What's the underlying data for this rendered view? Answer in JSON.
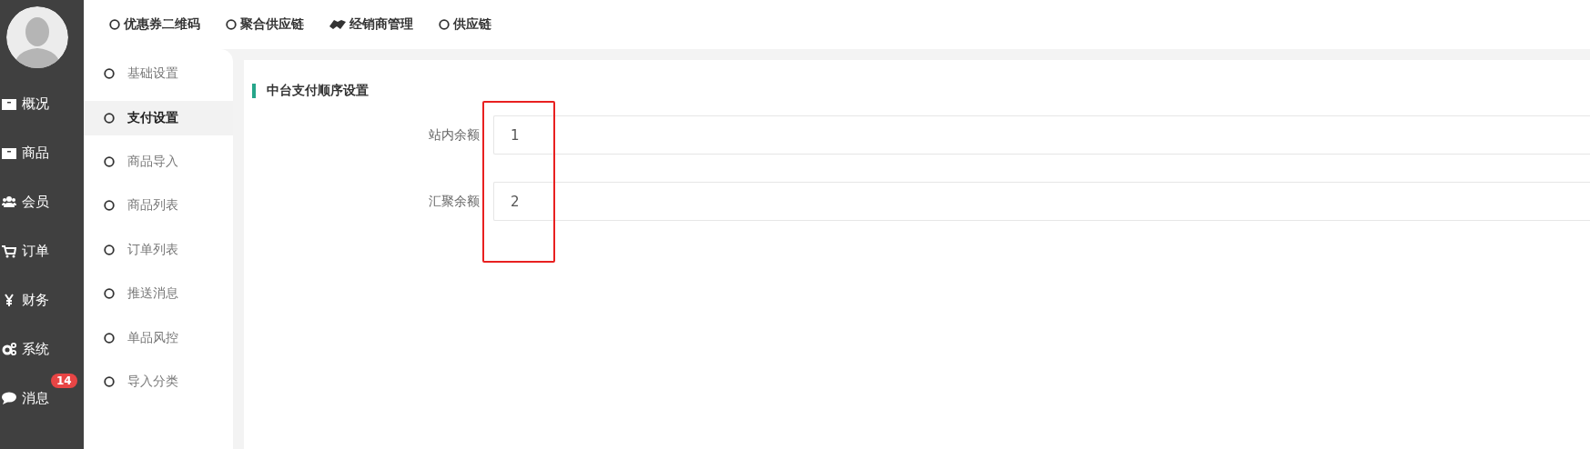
{
  "nav": [
    {
      "label": "概况"
    },
    {
      "label": "商品"
    },
    {
      "label": "会员"
    },
    {
      "label": "订单"
    },
    {
      "label": "财务"
    },
    {
      "label": "系统"
    },
    {
      "label": "消息",
      "badge": "14"
    }
  ],
  "top_menu": [
    {
      "label": "优惠券二维码"
    },
    {
      "label": "聚合供应链"
    },
    {
      "label": "经销商管理"
    },
    {
      "label": "供应链"
    }
  ],
  "submenu": [
    {
      "label": "基础设置",
      "selected": false
    },
    {
      "label": "支付设置",
      "selected": true
    },
    {
      "label": "商品导入",
      "selected": false
    },
    {
      "label": "商品列表",
      "selected": false
    },
    {
      "label": "订单列表",
      "selected": false
    },
    {
      "label": "推送消息",
      "selected": false
    },
    {
      "label": "单品风控",
      "selected": false
    },
    {
      "label": "导入分类",
      "selected": false
    }
  ],
  "section": {
    "title": "中台支付顺序设置"
  },
  "fields": [
    {
      "label": "站内余额",
      "value": "1"
    },
    {
      "label": "汇聚余额",
      "value": "2"
    }
  ]
}
